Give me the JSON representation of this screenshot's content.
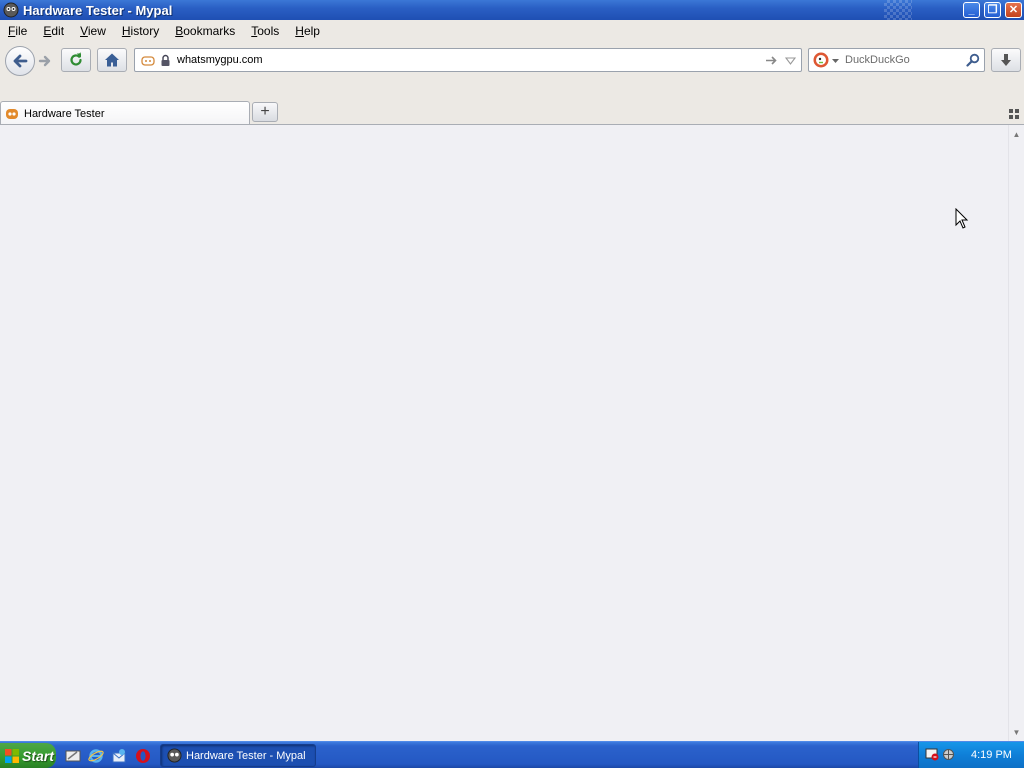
{
  "window": {
    "title": "Hardware Tester - Mypal",
    "controls": [
      "minimize",
      "restore",
      "close"
    ]
  },
  "menu": {
    "items": [
      {
        "label": "File",
        "accel": "F",
        "rest": "ile"
      },
      {
        "label": "Edit",
        "accel": "E",
        "rest": "dit"
      },
      {
        "label": "View",
        "accel": "V",
        "rest": "iew"
      },
      {
        "label": "History",
        "accel": "H",
        "rest": "istory"
      },
      {
        "label": "Bookmarks",
        "accel": "B",
        "rest": "ookmarks"
      },
      {
        "label": "Tools",
        "accel": "T",
        "rest": "ools"
      },
      {
        "label": "Help",
        "accel": "H",
        "rest": "elp"
      }
    ]
  },
  "navbar": {
    "url": "whatsmygpu.com",
    "search_placeholder": "DuckDuckGo",
    "icons": [
      "back-icon",
      "forward-icon",
      "reload-icon",
      "home-icon",
      "identity-icon",
      "lock-icon",
      "go-icon",
      "dropdown-icon",
      "duckduckgo-icon",
      "magnifier-icon",
      "download-icon"
    ]
  },
  "tabs": {
    "items": [
      {
        "label": "Hardware Tester",
        "active": true
      }
    ],
    "new_tab_label": "+"
  },
  "taskbar": {
    "start_label": "Start",
    "quick_launch": [
      "show-desktop-icon",
      "internet-explorer-icon",
      "outlook-express-icon",
      "opera-icon"
    ],
    "task_label": "Hardware Tester - Mypal",
    "clock": "4:19 PM"
  },
  "colors": {
    "titlebar": "#2a5fc4",
    "toolbar": "#ece9e4",
    "content": "#f0f0f4",
    "taskbar": "#2458c3",
    "start": "#339c2c",
    "tray": "#0f7fd8"
  }
}
